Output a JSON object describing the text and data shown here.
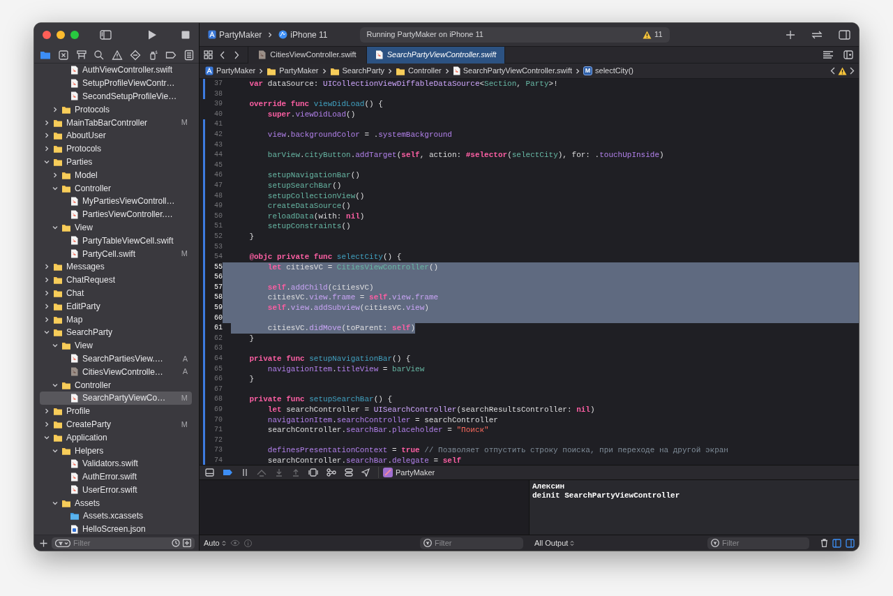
{
  "toolbar": {
    "scheme": "PartyMaker",
    "device": "iPhone 11",
    "activity": "Running PartyMaker on iPhone 11",
    "warning_count": "11"
  },
  "navigator_tabs": [
    {
      "kind": "project",
      "selected": true
    },
    {
      "kind": "source-control",
      "selected": false
    },
    {
      "kind": "symbols",
      "selected": false
    },
    {
      "kind": "find",
      "selected": false
    },
    {
      "kind": "issues",
      "selected": false
    },
    {
      "kind": "tests",
      "selected": false
    },
    {
      "kind": "debug",
      "selected": false
    },
    {
      "kind": "breakpoints",
      "selected": false
    },
    {
      "kind": "reports",
      "selected": false
    }
  ],
  "tree": [
    {
      "children": [
        {
          "children": [
            {
              "label": "AuthViewController.swift",
              "kind": "swift",
              "selected": false
            },
            {
              "label": "SetupProfileViewContr…",
              "kind": "swift",
              "selected": false
            },
            {
              "label": "SecondSetupProfileVie…",
              "kind": "swift",
              "selected": false
            }
          ]
        },
        {
          "label": "Protocols",
          "kind": "folder",
          "expanded": false,
          "selected": false
        }
      ]
    },
    {
      "label": "MainTabBarController",
      "kind": "folder",
      "expanded": false,
      "badge": "M",
      "selected": false
    },
    {
      "label": "AboutUser",
      "kind": "folder",
      "expanded": false,
      "selected": false
    },
    {
      "label": "Protocols",
      "kind": "folder",
      "expanded": false,
      "selected": false
    },
    {
      "label": "Parties",
      "kind": "folder",
      "expanded": true,
      "selected": false,
      "children": [
        {
          "label": "Model",
          "kind": "folder",
          "expanded": false,
          "selected": false
        },
        {
          "label": "Controller",
          "kind": "folder",
          "expanded": true,
          "selected": false,
          "children": [
            {
              "label": "MyPartiesViewControll…",
              "kind": "swift",
              "selected": false
            },
            {
              "label": "PartiesViewController.…",
              "kind": "swift",
              "selected": false
            }
          ]
        },
        {
          "label": "View",
          "kind": "folder",
          "expanded": true,
          "selected": false,
          "children": [
            {
              "label": "PartyTableViewCell.swift",
              "kind": "swift",
              "selected": false
            },
            {
              "label": "PartyCell.swift",
              "kind": "swift",
              "badge": "M",
              "selected": false
            }
          ]
        }
      ]
    },
    {
      "label": "Messages",
      "kind": "folder",
      "expanded": false,
      "selected": false
    },
    {
      "label": "ChatRequest",
      "kind": "folder",
      "expanded": false,
      "selected": false
    },
    {
      "label": "Chat",
      "kind": "folder",
      "expanded": false,
      "selected": false
    },
    {
      "label": "EditParty",
      "kind": "folder",
      "expanded": false,
      "selected": false
    },
    {
      "label": "Map",
      "kind": "folder",
      "expanded": false,
      "selected": false
    },
    {
      "label": "SearchParty",
      "kind": "folder",
      "expanded": true,
      "selected": false,
      "children": [
        {
          "label": "View",
          "kind": "folder",
          "expanded": true,
          "selected": false,
          "children": [
            {
              "label": "SearchPartiesView.…",
              "kind": "swift",
              "badge": "A",
              "selected": false
            },
            {
              "label": "CitiesViewControlle…",
              "kind": "swift-dim",
              "badge": "A",
              "selected": false
            }
          ]
        },
        {
          "label": "Controller",
          "kind": "folder",
          "expanded": true,
          "selected": false,
          "children": [
            {
              "label": "SearchPartyViewCo…",
              "kind": "swift",
              "badge": "M",
              "selected": true
            }
          ]
        }
      ]
    },
    {
      "label": "Profile",
      "kind": "folder",
      "expanded": false,
      "selected": false
    },
    {
      "label": "CreateParty",
      "kind": "folder",
      "expanded": false,
      "badge": "M",
      "selected": false
    },
    {
      "label": "Application",
      "kind": "folder",
      "expanded": true,
      "selected": false,
      "children": [
        {
          "label": "Helpers",
          "kind": "folder",
          "expanded": true,
          "selected": false,
          "children": [
            {
              "label": "Validators.swift",
              "kind": "swift",
              "selected": false
            },
            {
              "label": "AuthError.swift",
              "kind": "swift",
              "selected": false
            },
            {
              "label": "UserError.swift",
              "kind": "swift",
              "selected": false
            }
          ]
        },
        {
          "label": "Assets",
          "kind": "folder",
          "expanded": true,
          "selected": false,
          "children": [
            {
              "label": "Assets.xcassets",
              "kind": "assets",
              "selected": false
            },
            {
              "label": "HelloScreen.json",
              "kind": "json",
              "selected": false
            }
          ]
        }
      ]
    }
  ],
  "navigator_filter": {
    "placeholder": "Filter"
  },
  "editor_tabs": [
    {
      "label": "CitiesViewController.swift",
      "selected": false
    },
    {
      "label": "SearchPartyViewController.swift",
      "selected": true
    }
  ],
  "breadcrumb": [
    {
      "label": "PartyMaker",
      "kind": "project"
    },
    {
      "label": "PartyMaker",
      "kind": "folder"
    },
    {
      "label": "SearchParty",
      "kind": "folder"
    },
    {
      "label": "Controller",
      "kind": "folder"
    },
    {
      "label": "SearchPartyViewController.swift",
      "kind": "swift"
    },
    {
      "label": "selectCity()",
      "kind": "method",
      "symbol": "M"
    }
  ],
  "code": {
    "lines": [
      {
        "number": "37",
        "changed": true,
        "tokens": [
          {
            "kind": "keyword",
            "text": "    var"
          },
          {
            "kind": "plain",
            "text": " dataSource: "
          },
          {
            "kind": "type",
            "text": "UICollectionViewDiffableDataSource"
          },
          {
            "kind": "plain",
            "text": "<"
          },
          {
            "kind": "project",
            "text": "Section"
          },
          {
            "kind": "plain",
            "text": ", "
          },
          {
            "kind": "project",
            "text": "Party"
          },
          {
            "kind": "plain",
            "text": ">!"
          }
        ]
      },
      {
        "number": "38",
        "changed": true
      },
      {
        "number": "39",
        "changed": false,
        "tokens": [
          {
            "kind": "keyword",
            "text": "    override"
          },
          {
            "kind": "keyword",
            "text": " func"
          },
          {
            "kind": "declaration",
            "text": " viewDidLoad"
          },
          {
            "kind": "plain",
            "text": "() {"
          }
        ]
      },
      {
        "number": "40",
        "changed": false,
        "tokens": [
          {
            "kind": "keyword",
            "text": "        super"
          },
          {
            "kind": "plain",
            "text": "."
          },
          {
            "kind": "system",
            "text": "viewDidLoad"
          },
          {
            "kind": "plain",
            "text": "()"
          }
        ]
      },
      {
        "number": "41",
        "changed": true
      },
      {
        "number": "42",
        "changed": true,
        "tokens": [
          {
            "kind": "system",
            "text": "        view"
          },
          {
            "kind": "plain",
            "text": "."
          },
          {
            "kind": "system",
            "text": "backgroundColor"
          },
          {
            "kind": "plain",
            "text": " = ."
          },
          {
            "kind": "system",
            "text": "systemBackground"
          }
        ]
      },
      {
        "number": "43",
        "changed": true
      },
      {
        "number": "44",
        "changed": true,
        "tokens": [
          {
            "kind": "project",
            "text": "        barView"
          },
          {
            "kind": "plain",
            "text": "."
          },
          {
            "kind": "project",
            "text": "cityButton"
          },
          {
            "kind": "plain",
            "text": "."
          },
          {
            "kind": "system",
            "text": "addTarget"
          },
          {
            "kind": "plain",
            "text": "("
          },
          {
            "kind": "keyword",
            "text": "self"
          },
          {
            "kind": "plain",
            "text": ", action: "
          },
          {
            "kind": "keyword",
            "text": "#selector"
          },
          {
            "kind": "plain",
            "text": "("
          },
          {
            "kind": "project",
            "text": "selectCity"
          },
          {
            "kind": "plain",
            "text": "), for: ."
          },
          {
            "kind": "system",
            "text": "touchUpInside"
          },
          {
            "kind": "plain",
            "text": ")"
          }
        ]
      },
      {
        "number": "45",
        "changed": true
      },
      {
        "number": "46",
        "changed": true,
        "tokens": [
          {
            "kind": "project",
            "text": "        setupNavigationBar"
          },
          {
            "kind": "plain",
            "text": "()"
          }
        ]
      },
      {
        "number": "47",
        "changed": true,
        "tokens": [
          {
            "kind": "project",
            "text": "        setupSearchBar"
          },
          {
            "kind": "plain",
            "text": "()"
          }
        ]
      },
      {
        "number": "48",
        "changed": true,
        "tokens": [
          {
            "kind": "project",
            "text": "        setupCollectionView"
          },
          {
            "kind": "plain",
            "text": "()"
          }
        ]
      },
      {
        "number": "49",
        "changed": true,
        "tokens": [
          {
            "kind": "project",
            "text": "        createDataSource"
          },
          {
            "kind": "plain",
            "text": "()"
          }
        ]
      },
      {
        "number": "50",
        "changed": true,
        "tokens": [
          {
            "kind": "project",
            "text": "        reloadData"
          },
          {
            "kind": "plain",
            "text": "(with: "
          },
          {
            "kind": "keyword",
            "text": "nil"
          },
          {
            "kind": "plain",
            "text": ")"
          }
        ]
      },
      {
        "number": "51",
        "changed": true,
        "tokens": [
          {
            "kind": "project",
            "text": "        setupConstraints"
          },
          {
            "kind": "plain",
            "text": "()"
          }
        ]
      },
      {
        "number": "52",
        "changed": true,
        "tokens": [
          {
            "kind": "plain",
            "text": "    }"
          }
        ]
      },
      {
        "number": "53",
        "changed": true
      },
      {
        "number": "54",
        "changed": true,
        "tokens": [
          {
            "kind": "keyword",
            "text": "    @objc"
          },
          {
            "kind": "keyword",
            "text": " private"
          },
          {
            "kind": "keyword",
            "text": " func"
          },
          {
            "kind": "declaration",
            "text": " selectCity"
          },
          {
            "kind": "plain",
            "text": "() {"
          }
        ]
      },
      {
        "number": "55",
        "changed": true,
        "selected": true,
        "tokens": [
          {
            "kind": "keyword",
            "text": "        let"
          },
          {
            "kind": "plain",
            "text": " citiesVC = "
          },
          {
            "kind": "project",
            "text": "CitiesViewController"
          },
          {
            "kind": "plain",
            "text": "()"
          }
        ]
      },
      {
        "number": "56",
        "changed": true,
        "selected": true
      },
      {
        "number": "57",
        "changed": true,
        "selected": true,
        "tokens": [
          {
            "kind": "keyword",
            "text": "        self"
          },
          {
            "kind": "plain",
            "text": "."
          },
          {
            "kind": "system",
            "text": "addChild"
          },
          {
            "kind": "plain",
            "text": "(citiesVC)"
          }
        ]
      },
      {
        "number": "58",
        "changed": true,
        "selected": true,
        "tokens": [
          {
            "kind": "plain",
            "text": "        citiesVC."
          },
          {
            "kind": "system",
            "text": "view"
          },
          {
            "kind": "plain",
            "text": "."
          },
          {
            "kind": "system",
            "text": "frame"
          },
          {
            "kind": "plain",
            "text": " = "
          },
          {
            "kind": "keyword",
            "text": "self"
          },
          {
            "kind": "plain",
            "text": "."
          },
          {
            "kind": "system",
            "text": "view"
          },
          {
            "kind": "plain",
            "text": "."
          },
          {
            "kind": "system",
            "text": "frame"
          }
        ]
      },
      {
        "number": "59",
        "changed": true,
        "selected": true,
        "tokens": [
          {
            "kind": "keyword",
            "text": "        self"
          },
          {
            "kind": "plain",
            "text": "."
          },
          {
            "kind": "system",
            "text": "view"
          },
          {
            "kind": "plain",
            "text": "."
          },
          {
            "kind": "system",
            "text": "addSubview"
          },
          {
            "kind": "plain",
            "text": "(citiesVC."
          },
          {
            "kind": "system",
            "text": "view"
          },
          {
            "kind": "plain",
            "text": ")"
          }
        ]
      },
      {
        "number": "60",
        "changed": true,
        "selected": true
      },
      {
        "number": "61",
        "changed": true,
        "selected": true,
        "partial": true,
        "tokens": [
          {
            "kind": "plain",
            "text": "        citiesVC."
          },
          {
            "kind": "system",
            "text": "didMove"
          },
          {
            "kind": "plain",
            "text": "(toParent: "
          },
          {
            "kind": "keyword",
            "text": "self"
          },
          {
            "kind": "plain",
            "text": ")"
          }
        ]
      },
      {
        "number": "62",
        "changed": true,
        "tokens": [
          {
            "kind": "plain",
            "text": "    }"
          }
        ]
      },
      {
        "number": "63",
        "changed": true
      },
      {
        "number": "64",
        "changed": true,
        "tokens": [
          {
            "kind": "keyword",
            "text": "    private"
          },
          {
            "kind": "keyword",
            "text": " func"
          },
          {
            "kind": "declaration",
            "text": " setupNavigationBar"
          },
          {
            "kind": "plain",
            "text": "() {"
          }
        ]
      },
      {
        "number": "65",
        "changed": true,
        "tokens": [
          {
            "kind": "system",
            "text": "        navigationItem"
          },
          {
            "kind": "plain",
            "text": "."
          },
          {
            "kind": "system",
            "text": "titleView"
          },
          {
            "kind": "plain",
            "text": " = "
          },
          {
            "kind": "project",
            "text": "barView"
          }
        ]
      },
      {
        "number": "66",
        "changed": true,
        "tokens": [
          {
            "kind": "plain",
            "text": "    }"
          }
        ]
      },
      {
        "number": "67",
        "changed": true
      },
      {
        "number": "68",
        "changed": true,
        "tokens": [
          {
            "kind": "keyword",
            "text": "    private"
          },
          {
            "kind": "keyword",
            "text": " func"
          },
          {
            "kind": "declaration",
            "text": " setupSearchBar"
          },
          {
            "kind": "plain",
            "text": "() {"
          }
        ]
      },
      {
        "number": "69",
        "changed": true,
        "tokens": [
          {
            "kind": "keyword",
            "text": "        let"
          },
          {
            "kind": "plain",
            "text": " searchController = "
          },
          {
            "kind": "type",
            "text": "UISearchController"
          },
          {
            "kind": "plain",
            "text": "(searchResultsController: "
          },
          {
            "kind": "keyword",
            "text": "nil"
          },
          {
            "kind": "plain",
            "text": ")"
          }
        ]
      },
      {
        "number": "70",
        "changed": true,
        "tokens": [
          {
            "kind": "system",
            "text": "        navigationItem"
          },
          {
            "kind": "plain",
            "text": "."
          },
          {
            "kind": "system",
            "text": "searchController"
          },
          {
            "kind": "plain",
            "text": " = searchController"
          }
        ]
      },
      {
        "number": "71",
        "changed": true,
        "tokens": [
          {
            "kind": "plain",
            "text": "        searchController."
          },
          {
            "kind": "system",
            "text": "searchBar"
          },
          {
            "kind": "plain",
            "text": "."
          },
          {
            "kind": "system",
            "text": "placeholder"
          },
          {
            "kind": "plain",
            "text": " = "
          },
          {
            "kind": "string",
            "text": "\"Поиск\""
          }
        ]
      },
      {
        "number": "72",
        "changed": true
      },
      {
        "number": "73",
        "changed": true,
        "tokens": [
          {
            "kind": "system",
            "text": "        definesPresentationContext"
          },
          {
            "kind": "plain",
            "text": " = "
          },
          {
            "kind": "keyword",
            "text": "true"
          },
          {
            "kind": "comment",
            "text": " // Позволяет отпустить строку поиска, при переходе на другой экран"
          }
        ]
      },
      {
        "number": "74",
        "changed": true,
        "tokens": [
          {
            "kind": "plain",
            "text": "        searchController."
          },
          {
            "kind": "system",
            "text": "searchBar"
          },
          {
            "kind": "plain",
            "text": "."
          },
          {
            "kind": "system",
            "text": "delegate"
          },
          {
            "kind": "plain",
            "text": " = "
          },
          {
            "kind": "keyword",
            "text": "self"
          }
        ]
      }
    ]
  },
  "debug_bar": {
    "target": "PartyMaker",
    "breakpoints_on": true
  },
  "variables_pane": {
    "scope": "Auto",
    "filter_placeholder": "Filter"
  },
  "console": {
    "lines": [
      "Алексин",
      "deinit SearchPartyViewController"
    ],
    "output": "All Output",
    "filter_placeholder": "Filter"
  }
}
